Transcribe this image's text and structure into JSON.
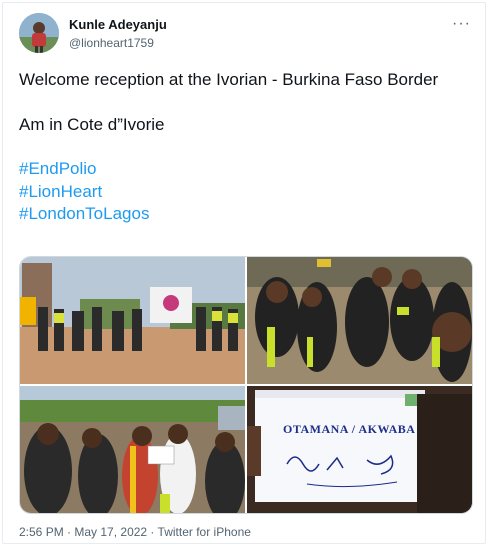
{
  "user": {
    "display_name": "Kunle Adeyanju",
    "handle": "@lionheart1759"
  },
  "more_icon": "more-horizontal-icon",
  "tweet": {
    "line1": "Welcome reception at the Ivorian - Burkina Faso Border",
    "line2": "Am in Cote d”Ivorie",
    "hashtags": [
      "#EndPolio",
      "#LionHeart",
      "#LondonToLagos"
    ]
  },
  "photo_text": {
    "banner": "OTAMANA / AKWABA"
  },
  "footer": {
    "time": "2:56 PM",
    "sep1": " · ",
    "date": "May 17, 2022",
    "sep2": " · ",
    "source": "Twitter for iPhone"
  },
  "colors": {
    "link": "#1d9bf0",
    "secondary_text": "#536471",
    "border": "#cfd9de"
  }
}
